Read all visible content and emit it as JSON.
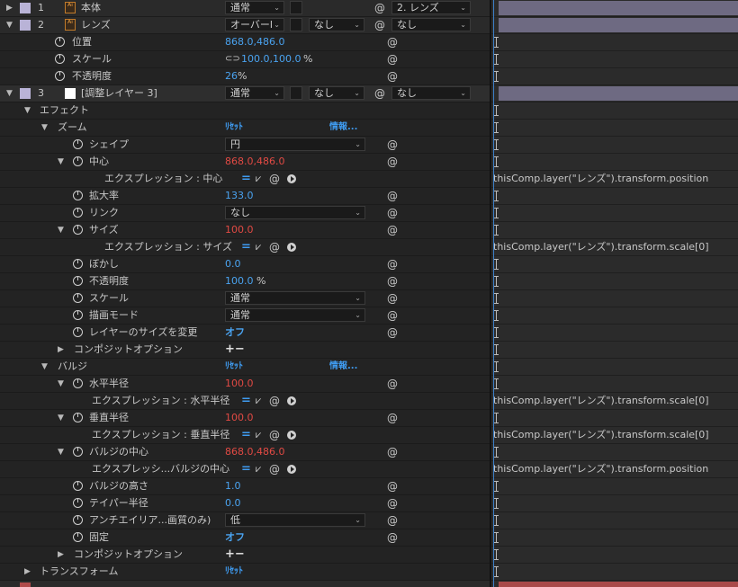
{
  "layers": [
    {
      "num": "1",
      "name": "本体",
      "mode": "通常",
      "trkmat": "",
      "parent": "2. レンズ"
    },
    {
      "num": "2",
      "name": "レンズ",
      "mode": "オーバーl",
      "trkmat": "なし",
      "parent": "なし"
    }
  ],
  "lens_props": [
    {
      "name": "位置",
      "value": "868.0,486.0"
    },
    {
      "name": "スケール",
      "value_a": "100.0,100.0",
      "unit": "%"
    },
    {
      "name": "不透明度",
      "value": "26",
      "unit": "%"
    }
  ],
  "layer3": {
    "num": "3",
    "name": "[調整レイヤー 3]",
    "mode": "通常",
    "trkmat": "なし",
    "parent": "なし"
  },
  "effects_label": "エフェクト",
  "reset": "ﾘｾｯﾄ",
  "info": "情報...",
  "zoom": {
    "name": "ズーム",
    "shape_label": "シェイプ",
    "shape_value": "円",
    "center_label": "中心",
    "center_value": "868.0,486.0",
    "center_expr_label": "エクスプレッション : 中心",
    "mag_label": "拡大率",
    "mag_value": "133.0",
    "link_label": "リンク",
    "link_value": "なし",
    "size_label": "サイズ",
    "size_value": "100.0",
    "size_expr_label": "エクスプレッション : サイズ",
    "blur_label": "ぼかし",
    "blur_value": "0.0",
    "opacity_label": "不透明度",
    "opacity_value": "100.0",
    "opacity_unit": "%",
    "scale_label": "スケール",
    "scale_value": "通常",
    "mode_label": "描画モード",
    "mode_value": "通常",
    "resize_label": "レイヤーのサイズを変更",
    "resize_value": "オフ",
    "composite_label": "コンポジットオプション"
  },
  "bulge": {
    "name": "バルジ",
    "hr_label": "水平半径",
    "hr_value": "100.0",
    "hr_expr_label": "エクスプレッション : 水平半径",
    "vr_label": "垂直半径",
    "vr_value": "100.0",
    "vr_expr_label": "エクスプレッション : 垂直半径",
    "center_label": "バルジの中心",
    "center_value": "868.0,486.0",
    "center_expr_label": "エクスプレッシ...バルジの中心",
    "height_label": "バルジの高さ",
    "height_value": "1.0",
    "taper_label": "テイパー半径",
    "taper_value": "0.0",
    "aa_label": "アンチエイリア...画質のみ)",
    "aa_value": "低",
    "pin_label": "固定",
    "pin_value": "オフ",
    "composite_label": "コンポジットオプション"
  },
  "transform_label": "トランスフォーム",
  "expressions": {
    "pos": "thisComp.layer(\"レンズ\").transform.position",
    "scale0": "thisComp.layer(\"レンズ\").transform.scale[0]"
  },
  "colors": {
    "blue_value": "#4aa3f0",
    "red_value": "#e24a44",
    "lens_label": "#b9b3d7"
  }
}
